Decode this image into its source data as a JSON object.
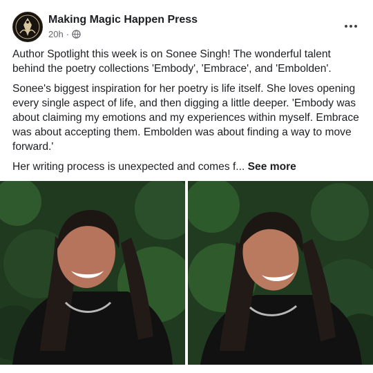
{
  "post": {
    "page_name": "Making Magic Happen Press",
    "time": "20h",
    "separator": "·",
    "paragraphs": [
      "Author Spotlight this week is on Sonee Singh! The wonderful talent behind the poetry collections 'Embody', 'Embrace', and 'Embolden'.",
      "Sonee's biggest inspiration for her poetry is life itself. She loves opening every single aspect of life, and then digging a little deeper. 'Embody was about claiming my emotions and my experiences within myself. Embrace was about accepting them. Embolden was about finding a way to move forward.'"
    ],
    "truncated_text": "Her writing process is unexpected and comes f...",
    "see_more": "See more"
  },
  "icons": {
    "privacy": "globe-icon",
    "menu": "more-horizontal-icon"
  },
  "colors": {
    "text": "#1c1e21",
    "secondary_text": "#65676b",
    "photo_background": "#1f3a1f"
  }
}
